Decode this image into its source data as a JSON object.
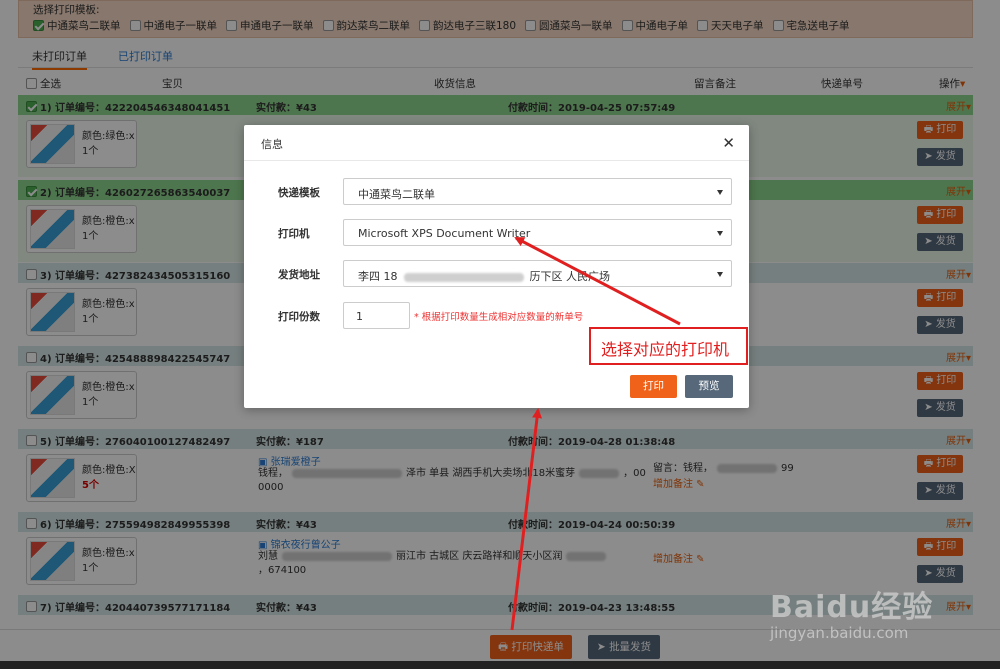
{
  "template_bar": {
    "title": "选择打印模板:",
    "options": [
      {
        "label": "中通菜鸟二联单",
        "checked": true
      },
      {
        "label": "中通电子一联单",
        "checked": false
      },
      {
        "label": "申通电子一联单",
        "checked": false
      },
      {
        "label": "韵达菜鸟二联单",
        "checked": false
      },
      {
        "label": "韵达电子三联180",
        "checked": false
      },
      {
        "label": "圆通菜鸟一联单",
        "checked": false
      },
      {
        "label": "中通电子单",
        "checked": false
      },
      {
        "label": "天天电子单",
        "checked": false
      },
      {
        "label": "宅急送电子单",
        "checked": false
      }
    ]
  },
  "tabs": {
    "unprinted": "未打印订单",
    "printed": "已打印订单"
  },
  "table_header": {
    "select_all": "全选",
    "item": "宝贝",
    "receiver": "收货信息",
    "memo": "留言备注",
    "tracking": "快递单号",
    "actions": "操作"
  },
  "orders": [
    {
      "no": "1) 订单编号：422204546348041451",
      "paid": "实付款：¥43",
      "time": "付款时间：2019-04-25 07:57:49",
      "expand": "展开",
      "color": "颜色:绿色:x",
      "qty": "1个",
      "print": "打印",
      "ship": "发货"
    },
    {
      "no": "2) 订单编号：426027265863540037",
      "expand": "展开",
      "color": "颜色:橙色:x",
      "qty": "1个",
      "print": "打印",
      "ship": "发货"
    },
    {
      "no": "3) 订单编号：427382434505315160",
      "expand": "展开",
      "color": "颜色:橙色:x",
      "qty": "1个",
      "print": "打印",
      "ship": "发货"
    },
    {
      "no": "4) 订单编号：425488898422545747",
      "expand": "展开",
      "color": "颜色:橙色:x",
      "qty": "1个",
      "print": "打印",
      "ship": "发货"
    },
    {
      "no": "5) 订单编号：276040100127482497",
      "paid": "实付款：¥187",
      "time": "付款时间：2019-04-28 01:38:48",
      "expand": "展开",
      "color": "颜色:橙色:X",
      "qty": "5个",
      "receiver_name": "张瑞爱橙子",
      "addr_1": "钱程，",
      "addr_2": "泽市 单县 湖西手机大卖场北18米蜜芽",
      "addr_3": "，00",
      "addr_4": "0000",
      "memo": "留言：钱程，",
      "memo_tail": "99",
      "memo_add": "增加备注",
      "print": "打印",
      "ship": "发货"
    },
    {
      "no": "6) 订单编号：275594982849955398",
      "paid": "实付款：¥43",
      "time": "付款时间：2019-04-24 00:50:39",
      "expand": "展开",
      "color": "颜色:橙色:x",
      "qty": "1个",
      "receiver_name": "锦衣夜行曾公子",
      "addr_1": "刘慧",
      "addr_2": "丽江市 古城区 庆云路祥和顺天小区润",
      "addr_3": "",
      "addr_4": "，674100",
      "memo_add": "增加备注",
      "print": "打印",
      "ship": "发货"
    },
    {
      "no": "7) 订单编号：420440739577171184",
      "paid": "实付款：¥43",
      "time": "付款时间：2019-04-23 13:48:55",
      "expand": "展开"
    }
  ],
  "bottom_bar": {
    "print_label": "打印快递单",
    "ship_label": "批量发货"
  },
  "modal": {
    "title": "信息",
    "fields": {
      "template_label": "快递模板",
      "template_value": "中通菜鸟二联单",
      "printer_label": "打印机",
      "printer_value": "Microsoft XPS Document Writer",
      "address_label": "发货地址",
      "address_prefix": "李四 18",
      "address_suffix": "历下区 人民广场",
      "copies_label": "打印份数",
      "copies_value": "1",
      "copies_hint": "* 根据打印数量生成相对应数量的新单号"
    },
    "print_label": "打印",
    "preview_label": "预览"
  },
  "callout": {
    "text": "选择对应的打印机"
  },
  "watermark": {
    "logo": "Baidu经验",
    "url": "jingyan.baidu.com"
  },
  "colors": {
    "accent": "#f0621a",
    "secondary_button": "#56687a",
    "callout_red": "#e02020",
    "link_blue": "#2b7cd3"
  }
}
